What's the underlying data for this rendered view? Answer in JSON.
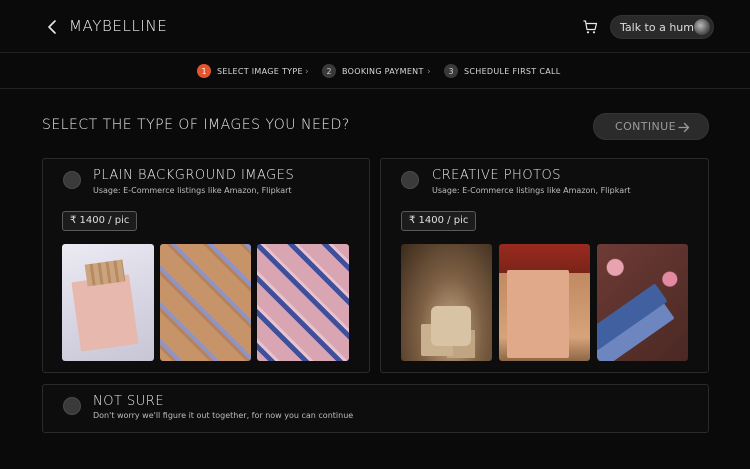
{
  "header": {
    "brand": "MAYBELLINE",
    "talk_label": "Talk to a human"
  },
  "steps": [
    {
      "num": "1",
      "label": "SELECT IMAGE TYPE",
      "active": true
    },
    {
      "num": "2",
      "label": "BOOKING PAYMENT",
      "active": false
    },
    {
      "num": "3",
      "label": "SCHEDULE FIRST CALL",
      "active": false
    }
  ],
  "main": {
    "question": "SELECT THE TYPE OF IMAGES YOU NEED?",
    "continue_label": "CONTINUE"
  },
  "options": [
    {
      "title": "PLAIN BACKGROUND IMAGES",
      "usage": "Usage: E-Commerce listings like Amazon, Flipkart",
      "price": "₹ 1400 / pic"
    },
    {
      "title": "CREATIVE PHOTOS",
      "usage": "Usage: E-Commerce listings like Amazon, Flipkart",
      "price": "₹ 1400 / pic"
    },
    {
      "title": "NOT SURE",
      "usage": "Don't worry we'll figure it out together, for now you can continue"
    }
  ],
  "colors": {
    "accent": "#e5552d",
    "background": "#0a0a0a"
  },
  "icons": {
    "back": "chevron-left-icon",
    "cart": "cart-icon",
    "continue": "arrow-right-icon"
  }
}
